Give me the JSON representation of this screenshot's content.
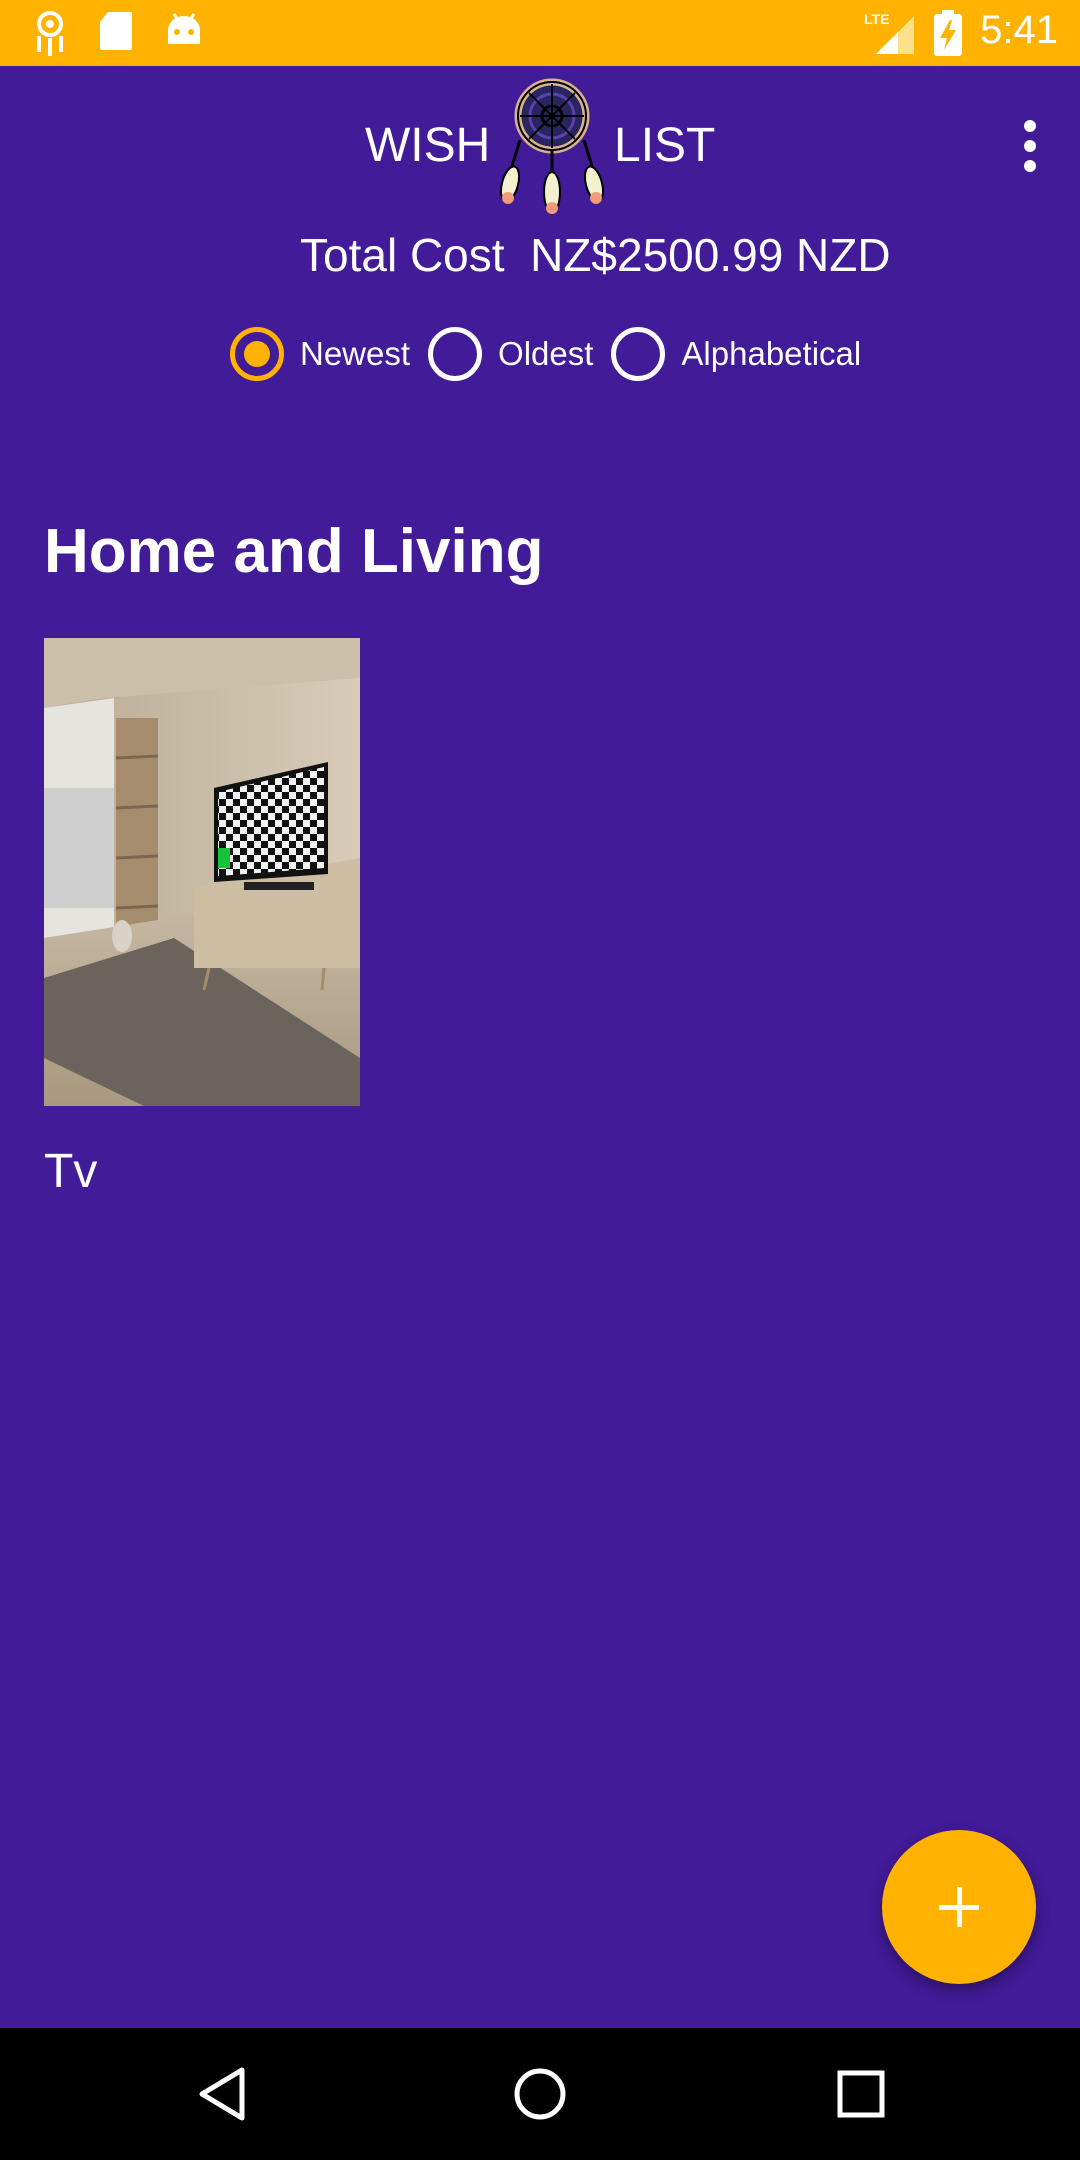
{
  "status_bar": {
    "time": "5:41",
    "icons": [
      "dreamcatcher-notification-icon",
      "sd-card-icon",
      "android-icon",
      "lte-signal-icon",
      "battery-charging-icon"
    ],
    "background": "#ffb300"
  },
  "header": {
    "title_left": "WISH",
    "title_right": "LIST",
    "logo": "dreamcatcher-logo-icon",
    "menu": "more-vert-icon"
  },
  "total_cost": {
    "label": "Total Cost",
    "value": "NZ$2500.99 NZD"
  },
  "sort_options": [
    {
      "label": "Newest",
      "selected": true
    },
    {
      "label": "Oldest",
      "selected": false
    },
    {
      "label": "Alphabetical",
      "selected": false
    }
  ],
  "categories": [
    {
      "title": "Home and Living",
      "items": [
        {
          "name": "Tv",
          "image": "living-room-tv-photo"
        }
      ]
    }
  ],
  "fab": {
    "icon": "add-icon"
  },
  "nav": {
    "back": "back-icon",
    "home": "home-icon",
    "recents": "recents-icon"
  },
  "colors": {
    "background": "#411b98",
    "accent": "#ffb300",
    "text": "#ffffff"
  }
}
